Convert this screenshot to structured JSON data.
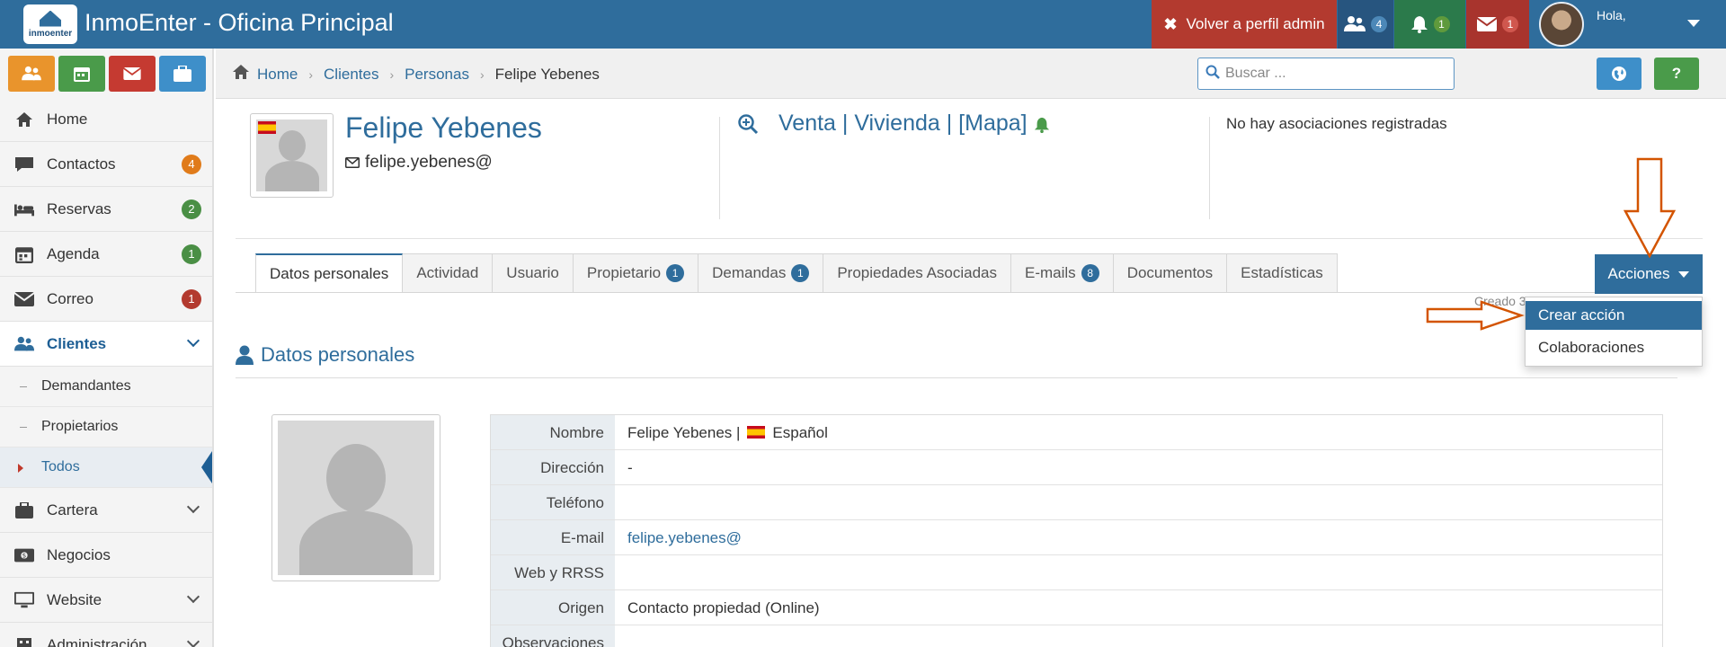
{
  "app": {
    "logo_text": "inmoenter",
    "title": "InmoEnter - Oficina Principal"
  },
  "topbar": {
    "admin_label": "Volver a perfil admin",
    "users_count": "4",
    "bell_count": "1",
    "mail_count": "1",
    "user_greeting": "Hola,"
  },
  "quick_buttons": [
    "users-icon",
    "calendar-icon",
    "mail-icon",
    "briefcase-icon"
  ],
  "sidebar": {
    "items": [
      {
        "label": "Home",
        "icon": "home-icon"
      },
      {
        "label": "Contactos",
        "icon": "chat-icon",
        "badge": "4",
        "badge_color": "#e07b1a"
      },
      {
        "label": "Reservas",
        "icon": "bed-icon",
        "badge": "2",
        "badge_color": "#4a8f45"
      },
      {
        "label": "Agenda",
        "icon": "calendar-icon",
        "badge": "1",
        "badge_color": "#4a8f45"
      },
      {
        "label": "Correo",
        "icon": "mail-icon",
        "badge": "1",
        "badge_color": "#b33a2f"
      },
      {
        "label": "Clientes",
        "icon": "users-icon"
      },
      {
        "label": "Cartera",
        "icon": "briefcase-icon"
      },
      {
        "label": "Negocios",
        "icon": "money-icon"
      },
      {
        "label": "Website",
        "icon": "monitor-icon"
      },
      {
        "label": "Administración",
        "icon": "building-icon"
      }
    ],
    "sub_items": [
      {
        "label": "Demandantes"
      },
      {
        "label": "Propietarios"
      },
      {
        "label": "Todos"
      }
    ]
  },
  "breadcrumb": {
    "items": [
      "Home",
      "Clientes",
      "Personas"
    ],
    "current": "Felipe Yebenes"
  },
  "search": {
    "placeholder": "Buscar ..."
  },
  "help_label": "?",
  "profile": {
    "name": "Felipe Yebenes",
    "email": "felipe.yebenes@",
    "interest": "Venta | Vivienda | [Mapa]",
    "associations": "No hay asociaciones registradas"
  },
  "tabs": [
    {
      "label": "Datos personales",
      "active": true
    },
    {
      "label": "Actividad"
    },
    {
      "label": "Usuario"
    },
    {
      "label": "Propietario",
      "badge": "1"
    },
    {
      "label": "Demandas",
      "badge": "1"
    },
    {
      "label": "Propiedades Asociadas"
    },
    {
      "label": "E-mails",
      "badge": "8"
    },
    {
      "label": "Documentos"
    },
    {
      "label": "Estadísticas"
    }
  ],
  "actions": {
    "button_label": "Acciones",
    "menu": [
      "Crear acción",
      "Colaboraciones"
    ],
    "created_text": "Creado 3"
  },
  "section": {
    "title": "Datos personales"
  },
  "details": {
    "rows": [
      {
        "key": "Nombre",
        "value": "Felipe Yebenes  |",
        "extra": "Español"
      },
      {
        "key": "Dirección",
        "value": "-"
      },
      {
        "key": "Teléfono",
        "value": ""
      },
      {
        "key": "E-mail",
        "value": "felipe.yebenes@"
      },
      {
        "key": "Web y RRSS",
        "value": ""
      },
      {
        "key": "Origen",
        "value": "Contacto propiedad (Online)"
      },
      {
        "key": "Observaciones",
        "value": ""
      }
    ]
  },
  "colors": {
    "primary": "#2f6d9c",
    "danger": "#b33a2f",
    "success": "#4a9b4a",
    "warning": "#e9942c",
    "annotation": "#d35400"
  }
}
